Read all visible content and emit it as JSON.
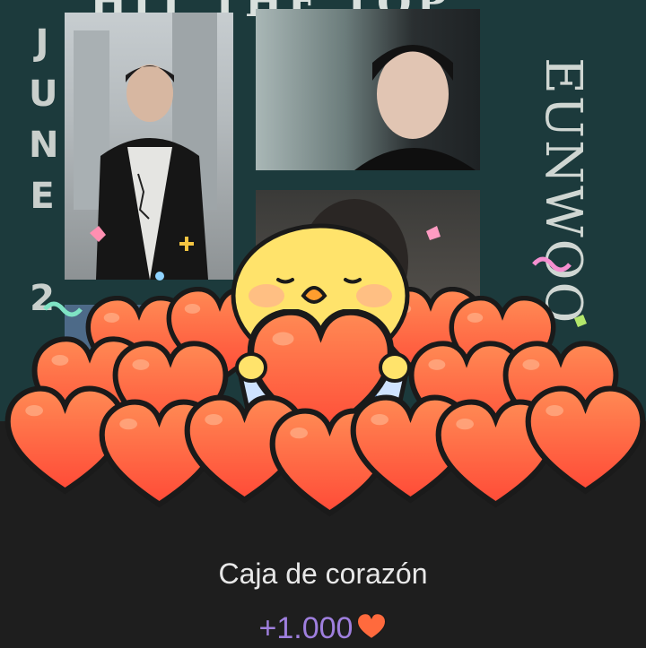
{
  "poster": {
    "title": "HIT THE TOP",
    "side_text": "JUNE 2",
    "vertical_text": "EUNWOO"
  },
  "gift": {
    "name": "Caja de corazón",
    "amount": "+1.000"
  },
  "colors": {
    "heart": "#ff6a3d",
    "heart_outline": "#1a1a1a",
    "chick": "#ffe36b",
    "amount": "#9f7fde",
    "background": "#1e1e1e",
    "poster_bg": "#1c3a3c"
  }
}
